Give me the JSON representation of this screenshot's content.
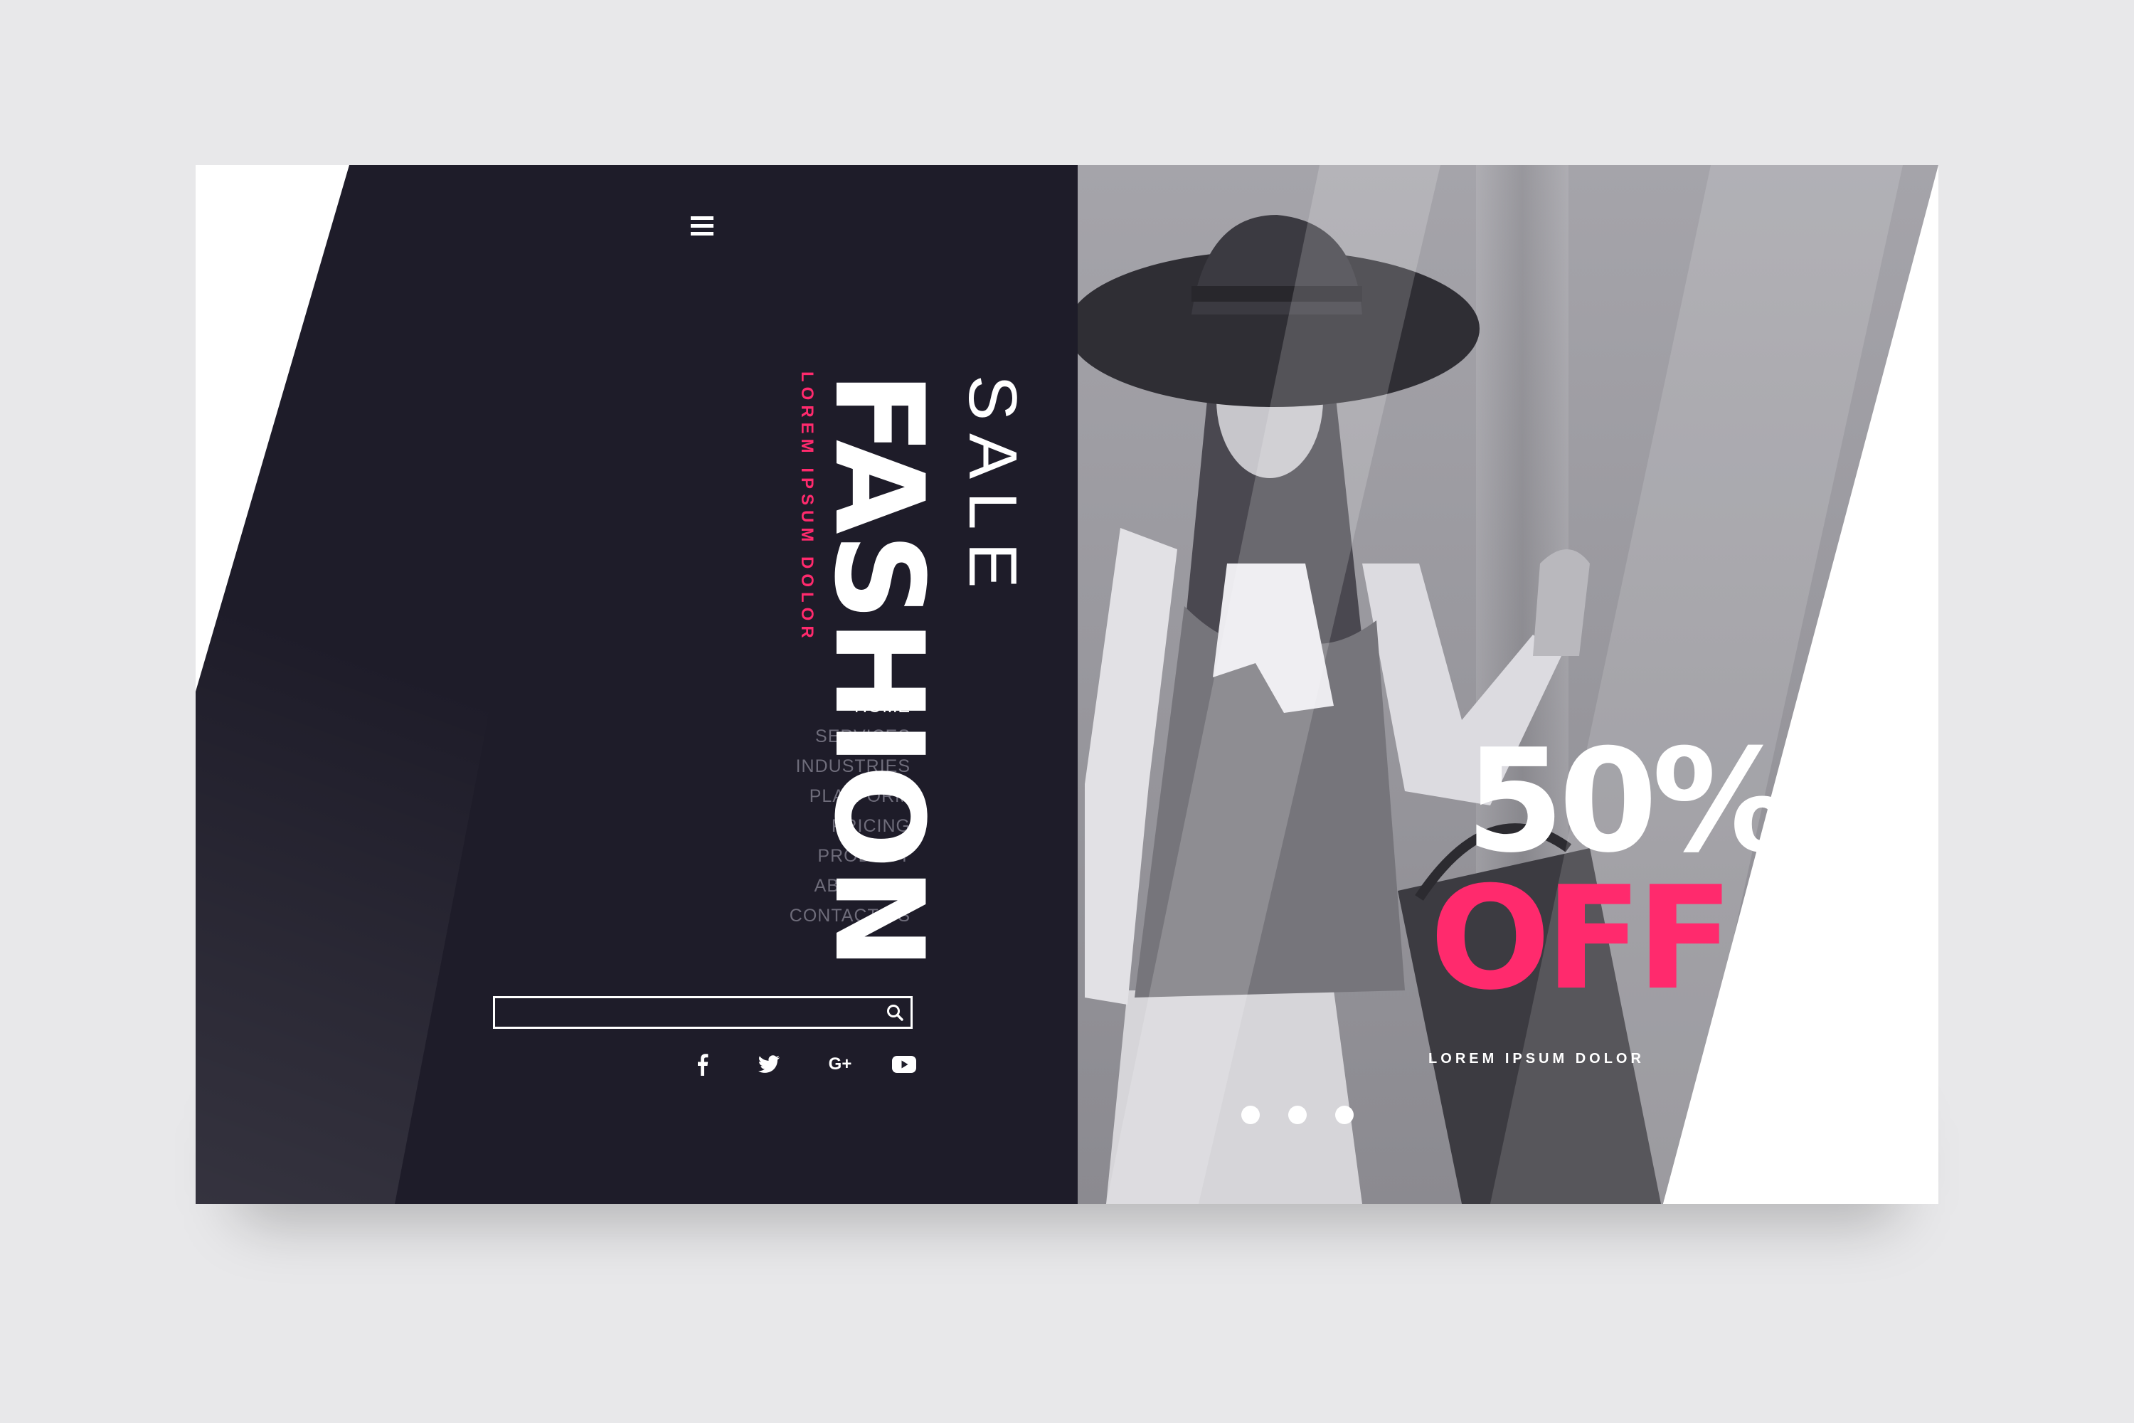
{
  "nav": {
    "items": [
      {
        "label": "HOME",
        "active": true
      },
      {
        "label": "SERVICES",
        "active": false
      },
      {
        "label": "INDUSTRIES",
        "active": false
      },
      {
        "label": "PLATFORM",
        "active": false
      },
      {
        "label": "PRICING",
        "active": false
      },
      {
        "label": "PRODUCT",
        "active": false
      },
      {
        "label": "ABOUT US",
        "active": false
      },
      {
        "label": "CONTACT US",
        "active": false
      }
    ]
  },
  "hero": {
    "tagline": "LOREM IPSUM DOLOR",
    "title": "FASHION",
    "subtitle": "SALE"
  },
  "promo": {
    "percent": "50%",
    "off": "OFF",
    "tagline": "LOREM IPSUM DOLOR"
  },
  "search": {
    "value": "",
    "icon": "search-icon"
  },
  "social": {
    "icons": [
      "facebook-icon",
      "twitter-icon",
      "google-plus-icon",
      "youtube-icon"
    ],
    "google_label": "G+"
  },
  "carousel": {
    "slide_count": 3
  },
  "colors": {
    "accent": "#ff2a6d",
    "dark": "#1e1c29",
    "background": "#e8e8ea",
    "text_muted": "#6e6c7a"
  }
}
